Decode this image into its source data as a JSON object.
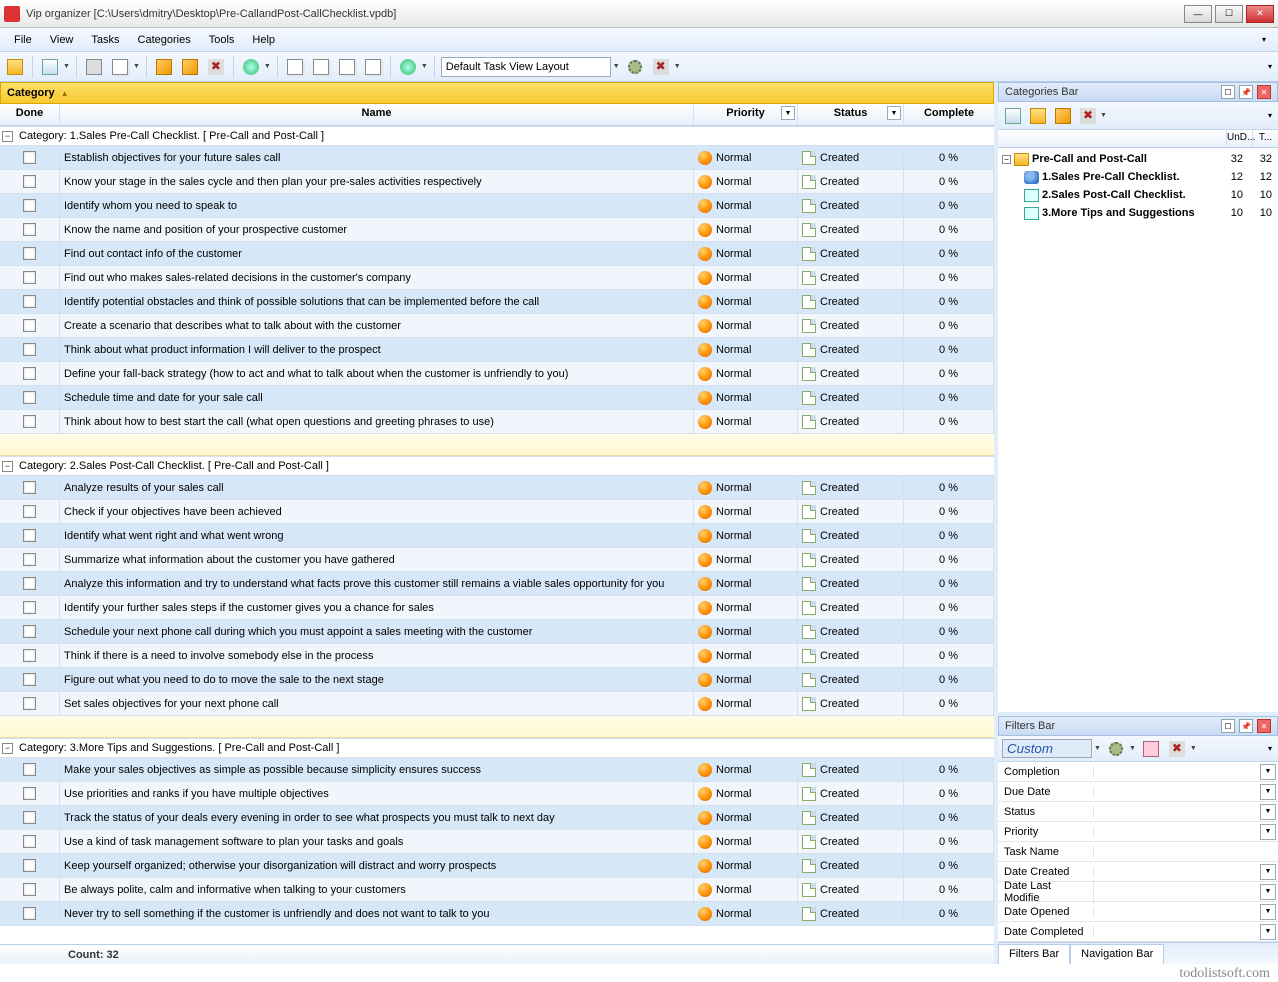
{
  "window": {
    "title": "Vip organizer [C:\\Users\\dmitry\\Desktop\\Pre-CallandPost-CallChecklist.vpdb]"
  },
  "menu": {
    "file": "File",
    "view": "View",
    "tasks": "Tasks",
    "categories": "Categories",
    "tools": "Tools",
    "help": "Help"
  },
  "toolbar": {
    "layout_label": "Default Task View Layout"
  },
  "grid": {
    "group_by": "Category",
    "columns": {
      "done": "Done",
      "name": "Name",
      "priority": "Priority",
      "status": "Status",
      "complete": "Complete"
    },
    "groups": [
      {
        "title": "Category: 1.Sales Pre-Call Checklist.    [ Pre-Call and Post-Call ]",
        "tasks": [
          {
            "name": "Establish objectives for your future sales call",
            "priority": "Normal",
            "status": "Created",
            "complete": "0 %"
          },
          {
            "name": "Know your stage in the sales cycle and then plan your pre-sales activities respectively",
            "priority": "Normal",
            "status": "Created",
            "complete": "0 %"
          },
          {
            "name": "Identify whom you need to speak to",
            "priority": "Normal",
            "status": "Created",
            "complete": "0 %"
          },
          {
            "name": "Know the name and position of your prospective customer",
            "priority": "Normal",
            "status": "Created",
            "complete": "0 %"
          },
          {
            "name": "Find out contact info of the customer",
            "priority": "Normal",
            "status": "Created",
            "complete": "0 %"
          },
          {
            "name": "Find out who makes sales-related decisions in the customer's company",
            "priority": "Normal",
            "status": "Created",
            "complete": "0 %"
          },
          {
            "name": "Identify potential obstacles and think of possible solutions that can be implemented before the call",
            "priority": "Normal",
            "status": "Created",
            "complete": "0 %"
          },
          {
            "name": "Create a scenario that describes what to talk about with the customer",
            "priority": "Normal",
            "status": "Created",
            "complete": "0 %"
          },
          {
            "name": "Think about what product information I will deliver to the prospect",
            "priority": "Normal",
            "status": "Created",
            "complete": "0 %"
          },
          {
            "name": "Define your fall-back strategy (how to act and what to talk about when the customer is unfriendly to you)",
            "priority": "Normal",
            "status": "Created",
            "complete": "0 %"
          },
          {
            "name": "Schedule time and date for your sale call",
            "priority": "Normal",
            "status": "Created",
            "complete": "0 %"
          },
          {
            "name": "Think about how to best start the call (what open questions and greeting phrases to use)",
            "priority": "Normal",
            "status": "Created",
            "complete": "0 %"
          }
        ]
      },
      {
        "title": "Category: 2.Sales Post-Call Checklist.    [ Pre-Call and Post-Call ]",
        "tasks": [
          {
            "name": "Analyze results of your sales call",
            "priority": "Normal",
            "status": "Created",
            "complete": "0 %"
          },
          {
            "name": "Check if your objectives have been achieved",
            "priority": "Normal",
            "status": "Created",
            "complete": "0 %"
          },
          {
            "name": "Identify what went right and what went wrong",
            "priority": "Normal",
            "status": "Created",
            "complete": "0 %"
          },
          {
            "name": "Summarize what information about the customer you have gathered",
            "priority": "Normal",
            "status": "Created",
            "complete": "0 %"
          },
          {
            "name": "Analyze this information and try to understand what facts prove this customer still remains a viable sales opportunity for you",
            "priority": "Normal",
            "status": "Created",
            "complete": "0 %"
          },
          {
            "name": "Identify your further sales steps if the customer gives you a chance for sales",
            "priority": "Normal",
            "status": "Created",
            "complete": "0 %"
          },
          {
            "name": "Schedule your next phone call during which you must appoint a sales meeting with the customer",
            "priority": "Normal",
            "status": "Created",
            "complete": "0 %"
          },
          {
            "name": "Think if there is a need to involve somebody else in the process",
            "priority": "Normal",
            "status": "Created",
            "complete": "0 %"
          },
          {
            "name": "Figure out what you need to do to move the sale to the next stage",
            "priority": "Normal",
            "status": "Created",
            "complete": "0 %"
          },
          {
            "name": "Set sales objectives for your next phone call",
            "priority": "Normal",
            "status": "Created",
            "complete": "0 %"
          }
        ]
      },
      {
        "title": "Category: 3.More Tips and Suggestions.    [ Pre-Call and Post-Call ]",
        "tasks": [
          {
            "name": "Make your sales objectives as simple as possible because simplicity ensures success",
            "priority": "Normal",
            "status": "Created",
            "complete": "0 %"
          },
          {
            "name": "Use priorities and ranks if you have multiple objectives",
            "priority": "Normal",
            "status": "Created",
            "complete": "0 %"
          },
          {
            "name": "Track the status of your deals every evening in order to see what prospects you must talk to next day",
            "priority": "Normal",
            "status": "Created",
            "complete": "0 %"
          },
          {
            "name": "Use a kind of task management software to plan your tasks and goals",
            "priority": "Normal",
            "status": "Created",
            "complete": "0 %"
          },
          {
            "name": "Keep yourself organized; otherwise your disorganization will distract and worry prospects",
            "priority": "Normal",
            "status": "Created",
            "complete": "0 %"
          },
          {
            "name": "Be always polite, calm and informative when talking to your customers",
            "priority": "Normal",
            "status": "Created",
            "complete": "0 %"
          },
          {
            "name": "Never try to sell something if the customer is unfriendly and does not want to talk to you",
            "priority": "Normal",
            "status": "Created",
            "complete": "0 %"
          }
        ]
      }
    ],
    "footer": {
      "count": "Count: 32"
    }
  },
  "categories_bar": {
    "title": "Categories Bar",
    "col1": "UnD...",
    "col2": "T...",
    "root": {
      "label": "Pre-Call and Post-Call",
      "c1": "32",
      "c2": "32"
    },
    "items": [
      {
        "label": "1.Sales Pre-Call Checklist.",
        "c1": "12",
        "c2": "12"
      },
      {
        "label": "2.Sales Post-Call Checklist.",
        "c1": "10",
        "c2": "10"
      },
      {
        "label": "3.More Tips and Suggestions",
        "c1": "10",
        "c2": "10"
      }
    ]
  },
  "filters_bar": {
    "title": "Filters Bar",
    "preset": "Custom",
    "rows": [
      {
        "label": "Completion",
        "drop": true
      },
      {
        "label": "Due Date",
        "drop": true
      },
      {
        "label": "Status",
        "drop": true
      },
      {
        "label": "Priority",
        "drop": true
      },
      {
        "label": "Task Name",
        "drop": false
      },
      {
        "label": "Date Created",
        "drop": true
      },
      {
        "label": "Date Last Modifie",
        "drop": true
      },
      {
        "label": "Date Opened",
        "drop": true
      },
      {
        "label": "Date Completed",
        "drop": true
      }
    ]
  },
  "side_tabs": {
    "t1": "Filters Bar",
    "t2": "Navigation Bar"
  },
  "watermark": "todolistsoft.com"
}
